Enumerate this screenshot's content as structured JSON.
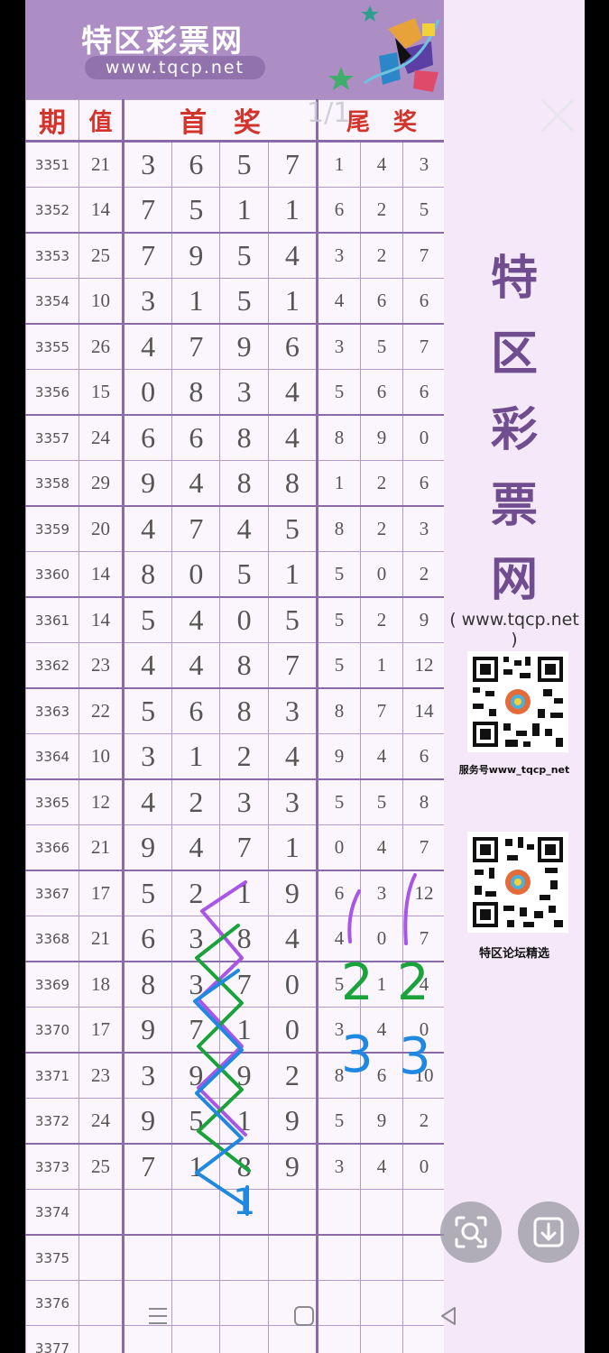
{
  "logo": {
    "title": "特区彩票网",
    "url": "www.tqcp.net"
  },
  "page_indicator": "1/1",
  "headers": {
    "period": "期",
    "value": "值",
    "first_prize": "首　奖",
    "tail_prize": "尾　奖"
  },
  "rows": [
    {
      "id": "3351",
      "val": "21",
      "f": [
        "3",
        "6",
        "5",
        "7"
      ],
      "t": [
        "1",
        "4",
        "3"
      ]
    },
    {
      "id": "3352",
      "val": "14",
      "f": [
        "7",
        "5",
        "1",
        "1"
      ],
      "t": [
        "6",
        "2",
        "5"
      ]
    },
    {
      "id": "3353",
      "val": "25",
      "f": [
        "7",
        "9",
        "5",
        "4"
      ],
      "t": [
        "3",
        "2",
        "7"
      ]
    },
    {
      "id": "3354",
      "val": "10",
      "f": [
        "3",
        "1",
        "5",
        "1"
      ],
      "t": [
        "4",
        "6",
        "6"
      ]
    },
    {
      "id": "3355",
      "val": "26",
      "f": [
        "4",
        "7",
        "9",
        "6"
      ],
      "t": [
        "3",
        "5",
        "7"
      ]
    },
    {
      "id": "3356",
      "val": "15",
      "f": [
        "0",
        "8",
        "3",
        "4"
      ],
      "t": [
        "5",
        "6",
        "6"
      ]
    },
    {
      "id": "3357",
      "val": "24",
      "f": [
        "6",
        "6",
        "8",
        "4"
      ],
      "t": [
        "8",
        "9",
        "0"
      ]
    },
    {
      "id": "3358",
      "val": "29",
      "f": [
        "9",
        "4",
        "8",
        "8"
      ],
      "t": [
        "1",
        "2",
        "6"
      ]
    },
    {
      "id": "3359",
      "val": "20",
      "f": [
        "4",
        "7",
        "4",
        "5"
      ],
      "t": [
        "8",
        "2",
        "3"
      ]
    },
    {
      "id": "3360",
      "val": "14",
      "f": [
        "8",
        "0",
        "5",
        "1"
      ],
      "t": [
        "5",
        "0",
        "2"
      ]
    },
    {
      "id": "3361",
      "val": "14",
      "f": [
        "5",
        "4",
        "0",
        "5"
      ],
      "t": [
        "5",
        "2",
        "9"
      ]
    },
    {
      "id": "3362",
      "val": "23",
      "f": [
        "4",
        "4",
        "8",
        "7"
      ],
      "t": [
        "5",
        "1",
        "12"
      ]
    },
    {
      "id": "3363",
      "val": "22",
      "f": [
        "5",
        "6",
        "8",
        "3"
      ],
      "t": [
        "8",
        "7",
        "14"
      ]
    },
    {
      "id": "3364",
      "val": "10",
      "f": [
        "3",
        "1",
        "2",
        "4"
      ],
      "t": [
        "9",
        "4",
        "6"
      ]
    },
    {
      "id": "3365",
      "val": "12",
      "f": [
        "4",
        "2",
        "3",
        "3"
      ],
      "t": [
        "5",
        "5",
        "8"
      ]
    },
    {
      "id": "3366",
      "val": "21",
      "f": [
        "9",
        "4",
        "7",
        "1"
      ],
      "t": [
        "0",
        "4",
        "7"
      ]
    },
    {
      "id": "3367",
      "val": "17",
      "f": [
        "5",
        "2",
        "1",
        "9"
      ],
      "t": [
        "6",
        "3",
        "12"
      ]
    },
    {
      "id": "3368",
      "val": "21",
      "f": [
        "6",
        "3",
        "8",
        "4"
      ],
      "t": [
        "4",
        "0",
        "7"
      ]
    },
    {
      "id": "3369",
      "val": "18",
      "f": [
        "8",
        "3",
        "7",
        "0"
      ],
      "t": [
        "5",
        "1",
        "4"
      ]
    },
    {
      "id": "3370",
      "val": "17",
      "f": [
        "9",
        "7",
        "1",
        "0"
      ],
      "t": [
        "3",
        "4",
        "0"
      ]
    },
    {
      "id": "3371",
      "val": "23",
      "f": [
        "3",
        "9",
        "9",
        "2"
      ],
      "t": [
        "8",
        "6",
        "10"
      ]
    },
    {
      "id": "3372",
      "val": "24",
      "f": [
        "9",
        "5",
        "1",
        "9"
      ],
      "t": [
        "5",
        "9",
        "2"
      ]
    },
    {
      "id": "3373",
      "val": "25",
      "f": [
        "7",
        "1",
        "8",
        "9"
      ],
      "t": [
        "3",
        "4",
        "0"
      ]
    },
    {
      "id": "3374",
      "val": "",
      "f": [
        "",
        "",
        "",
        ""
      ],
      "t": [
        "",
        "",
        ""
      ]
    },
    {
      "id": "3375",
      "val": "",
      "f": [
        "",
        "",
        "",
        ""
      ],
      "t": [
        "",
        "",
        ""
      ]
    },
    {
      "id": "3376",
      "val": "",
      "f": [
        "",
        "",
        "",
        ""
      ],
      "t": [
        "",
        "",
        ""
      ]
    },
    {
      "id": "3377",
      "val": "",
      "f": [
        "",
        "",
        "",
        ""
      ],
      "t": [
        "",
        "",
        ""
      ]
    }
  ],
  "side": {
    "chars": [
      "特",
      "区",
      "彩",
      "票",
      "网"
    ],
    "url": "( www.tqcp.net )",
    "qr1_caption": "服务号www_tqcp_net",
    "qr2_caption": "特区论坛精选"
  },
  "annotations": [
    "2",
    "2",
    "3",
    "3",
    "1"
  ],
  "colors": {
    "header_bg": "#ac8ec5",
    "title_red": "#d2332a",
    "grid": "#b39bc9",
    "ink_purple": "#a855e8",
    "ink_green": "#1aa33a",
    "ink_blue": "#1f88e0"
  },
  "icons": [
    "close-icon",
    "zoom-scan-icon",
    "download-icon",
    "menu-icon",
    "home-icon",
    "back-icon"
  ]
}
